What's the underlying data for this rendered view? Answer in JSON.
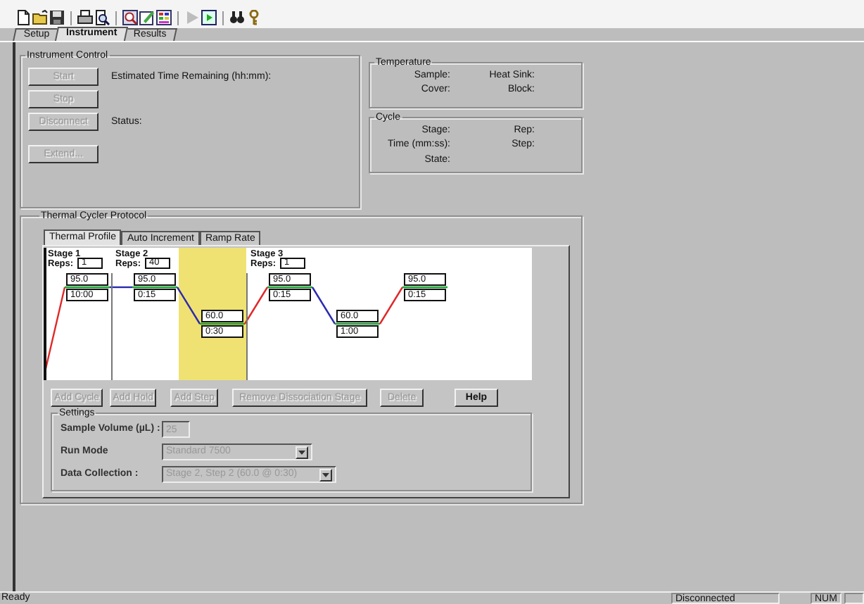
{
  "toolbar": [
    {
      "kind": "new",
      "disabled": false
    },
    {
      "kind": "open",
      "disabled": false
    },
    {
      "kind": "save",
      "disabled": false
    },
    {
      "kind": "sep"
    },
    {
      "kind": "print",
      "disabled": false
    },
    {
      "kind": "preview",
      "disabled": false
    },
    {
      "kind": "sep"
    },
    {
      "kind": "zoom",
      "disabled": false
    },
    {
      "kind": "edit",
      "disabled": false
    },
    {
      "kind": "grid",
      "disabled": false
    },
    {
      "kind": "sep"
    },
    {
      "kind": "play",
      "disabled": true
    },
    {
      "kind": "run",
      "disabled": false
    },
    {
      "kind": "sep"
    },
    {
      "kind": "find",
      "disabled": false
    },
    {
      "kind": "key",
      "disabled": false
    }
  ],
  "tabs": [
    {
      "label": "Setup",
      "selected": false
    },
    {
      "label": "Instrument",
      "selected": true
    },
    {
      "label": "Results",
      "selected": false
    }
  ],
  "instrument_control": {
    "title": "Instrument Control",
    "buttons": [
      {
        "label": "Start",
        "disabled": true
      },
      {
        "label": "Stop",
        "disabled": true
      },
      {
        "label": "Disconnect",
        "disabled": true
      },
      {
        "label": "Extend...",
        "disabled": true
      }
    ],
    "estimated_label": "Estimated Time Remaining (hh:mm):",
    "status_label": "Status:"
  },
  "temperature": {
    "title": "Temperature",
    "labels": [
      "Sample:",
      "Heat Sink:",
      "Cover:",
      "Block:"
    ]
  },
  "cycle": {
    "title": "Cycle",
    "labels": [
      "Stage:",
      "Rep:",
      "Time (mm:ss):",
      "Step:",
      "State:"
    ]
  },
  "protocol": {
    "title": "Thermal Cycler Protocol",
    "tabs": [
      {
        "label": "Thermal Profile",
        "selected": true
      },
      {
        "label": "Auto Increment",
        "selected": false
      },
      {
        "label": "Ramp Rate",
        "selected": false
      }
    ],
    "stages": [
      {
        "label": "Stage 1",
        "reps_label": "Reps:",
        "reps": "1",
        "steps": [
          {
            "temp": "95.0",
            "time": "10:00",
            "selected": false
          }
        ]
      },
      {
        "label": "Stage 2",
        "reps_label": "Reps:",
        "reps": "40",
        "steps": [
          {
            "temp": "95.0",
            "time": "0:15",
            "selected": false
          },
          {
            "temp": "60.0",
            "time": "0:30",
            "selected": true
          }
        ]
      },
      {
        "label": "Stage 3",
        "reps_label": "Reps:",
        "reps": "1",
        "steps": [
          {
            "temp": "95.0",
            "time": "0:15",
            "selected": false
          },
          {
            "temp": "60.0",
            "time": "1:00",
            "selected": false
          },
          {
            "temp": "95.0",
            "time": "0:15",
            "selected": false
          }
        ]
      }
    ],
    "buttons": [
      {
        "label": "Add Cycle",
        "disabled": true
      },
      {
        "label": "Add Hold",
        "disabled": true
      },
      {
        "label": "Add Step",
        "disabled": true
      },
      {
        "label": "Remove Dissociation Stage",
        "disabled": true
      },
      {
        "label": "Delete",
        "disabled": true
      },
      {
        "label": "Help",
        "disabled": false
      }
    ],
    "settings": {
      "title": "Settings",
      "sample_volume": {
        "label": "Sample Volume (µL) :",
        "value": "25",
        "disabled": true
      },
      "run_mode": {
        "label": "Run Mode",
        "value": "Standard 7500",
        "disabled": true
      },
      "data_collection": {
        "label": "Data Collection :",
        "value": "Stage 2, Step 2 (60.0 @ 0:30)",
        "disabled": true
      }
    }
  },
  "status_bar": {
    "message": "Ready",
    "panes": [
      "Disconnected",
      "NUM"
    ]
  }
}
